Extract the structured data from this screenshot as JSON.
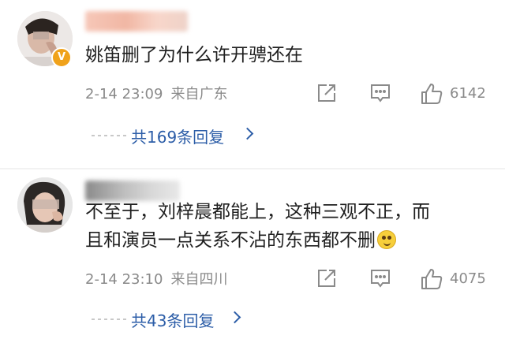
{
  "comments": [
    {
      "text": "姚笛删了为什么许开骋还在",
      "date": "2-14 23:09",
      "location": "来自广东",
      "likes": "6142",
      "replies": "共169条回复",
      "verified": true
    },
    {
      "text_line1": "不至于，刘梓晨都能上，这种三观不正，而",
      "text_line2": "且和演员一点关系不沾的东西都不删",
      "date": "2-14 23:10",
      "location": "来自四川",
      "likes": "4075",
      "replies": "共43条回复",
      "verified": false
    }
  ],
  "colors": {
    "link": "#2d5ea8",
    "meta": "#8a8a8a",
    "badge": "#f0a21b"
  }
}
